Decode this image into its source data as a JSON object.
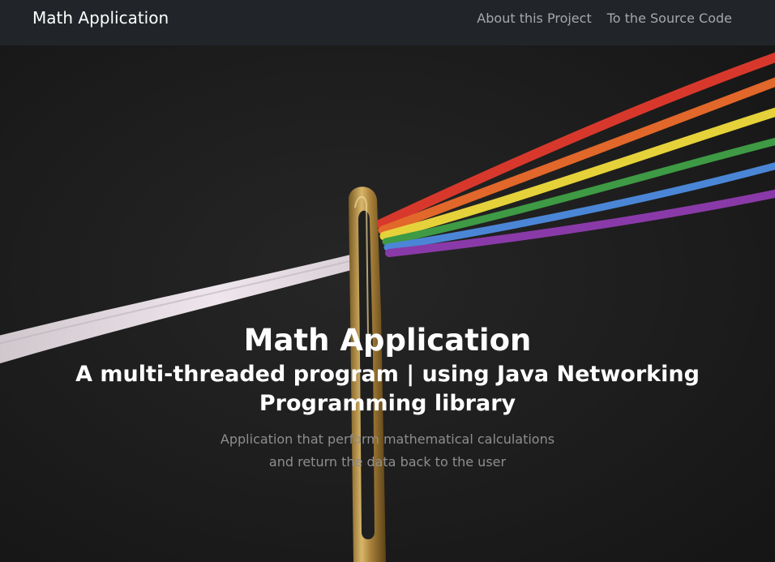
{
  "navbar": {
    "brand": "Math Application",
    "links": [
      {
        "label": "About this Project"
      },
      {
        "label": "To the Source Code"
      }
    ]
  },
  "hero": {
    "title": "Math Application",
    "subtitle": "A multi-threaded program | using Java Networking Programming library",
    "description": "Application that perform mathematical calculations and return the data back to the user"
  },
  "colors": {
    "navbar_bg": "#212529",
    "hero_bg": "#1f1f1f",
    "thread_white": "#e8e0e6",
    "thread_red": "#d8382c",
    "thread_orange": "#e2672a",
    "thread_yellow": "#e5d23a",
    "thread_green": "#3e9a44",
    "thread_blue": "#4b86d6",
    "thread_purple": "#8a3aa8",
    "needle_gold": "#b9934a"
  }
}
